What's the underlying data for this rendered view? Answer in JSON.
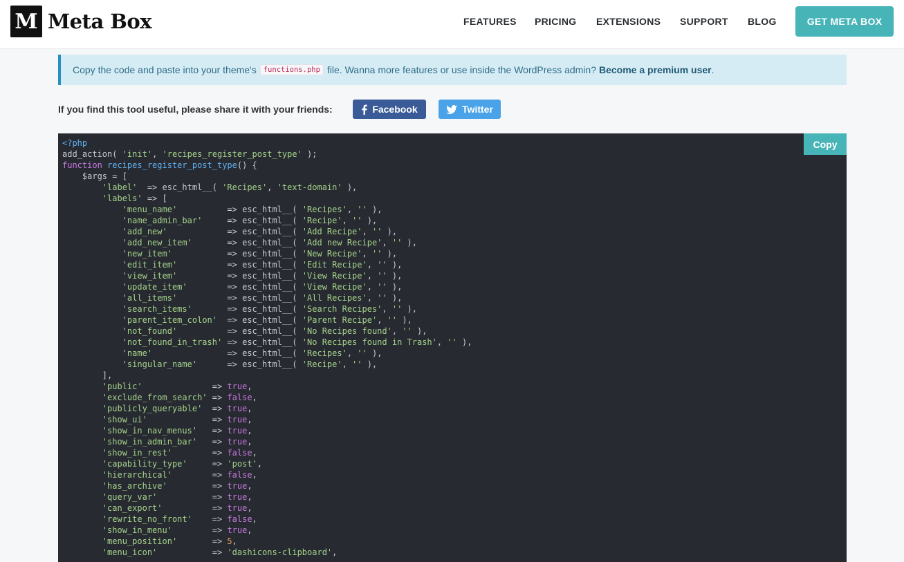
{
  "header": {
    "logo_mark": "M",
    "logo_text": "Meta Box",
    "nav": [
      "FEATURES",
      "PRICING",
      "EXTENSIONS",
      "SUPPORT",
      "BLOG"
    ],
    "cta": "GET META BOX"
  },
  "notice": {
    "text_before": "Copy the code and paste into your theme's",
    "code": "functions.php",
    "text_after": "file. Wanna more features or use inside the WordPress admin?",
    "link": "Become a premium user",
    "end": "."
  },
  "share": {
    "label": "If you find this tool useful, please share it with your friends:",
    "facebook": "Facebook",
    "twitter": "Twitter"
  },
  "code_block": {
    "copy_label": "Copy",
    "lines": [
      "<?php",
      "add_action( 'init', 'recipes_register_post_type' );",
      "function recipes_register_post_type() {",
      "    $args = [",
      "        'label'  => esc_html__( 'Recipes', 'text-domain' ),",
      "        'labels' => [",
      "            'menu_name'          => esc_html__( 'Recipes', '' ),",
      "            'name_admin_bar'     => esc_html__( 'Recipe', '' ),",
      "            'add_new'            => esc_html__( 'Add Recipe', '' ),",
      "            'add_new_item'       => esc_html__( 'Add new Recipe', '' ),",
      "            'new_item'           => esc_html__( 'New Recipe', '' ),",
      "            'edit_item'          => esc_html__( 'Edit Recipe', '' ),",
      "            'view_item'          => esc_html__( 'View Recipe', '' ),",
      "            'update_item'        => esc_html__( 'View Recipe', '' ),",
      "            'all_items'          => esc_html__( 'All Recipes', '' ),",
      "            'search_items'       => esc_html__( 'Search Recipes', '' ),",
      "            'parent_item_colon'  => esc_html__( 'Parent Recipe', '' ),",
      "            'not_found'          => esc_html__( 'No Recipes found', '' ),",
      "            'not_found_in_trash' => esc_html__( 'No Recipes found in Trash', '' ),",
      "            'name'               => esc_html__( 'Recipes', '' ),",
      "            'singular_name'      => esc_html__( 'Recipe', '' ),",
      "        ],",
      "        'public'              => true,",
      "        'exclude_from_search' => false,",
      "        'publicly_queryable'  => true,",
      "        'show_ui'             => true,",
      "        'show_in_nav_menus'   => true,",
      "        'show_in_admin_bar'   => true,",
      "        'show_in_rest'        => false,",
      "        'capability_type'     => 'post',",
      "        'hierarchical'        => false,",
      "        'has_archive'         => true,",
      "        'query_var'           => true,",
      "        'can_export'          => true,",
      "        'rewrite_no_front'    => false,",
      "        'show_in_menu'        => true,",
      "        'menu_position'       => 5,",
      "        'menu_icon'           => 'dashicons-clipboard',"
    ]
  },
  "colors": {
    "accent": "#47b4b8",
    "facebook": "#3a5a98",
    "twitter": "#4aa3e8",
    "code_bg": "#272a31",
    "string": "#a6d38b",
    "keyword": "#c678dd"
  }
}
